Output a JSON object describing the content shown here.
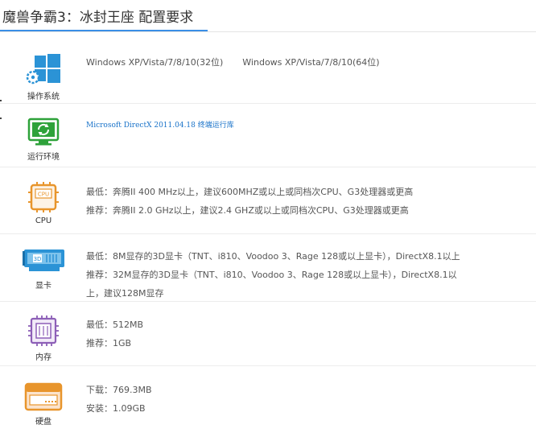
{
  "header": {
    "title": "魔兽争霸3：冰封王座 配置要求"
  },
  "colors": {
    "accent": "#3a8ee6",
    "icon_blue": "#2b93d6",
    "icon_green": "#2ea23a",
    "icon_orange": "#e8952c",
    "icon_purple": "#8d5fb7",
    "link": "#1a73c9"
  },
  "rows": [
    {
      "key": "os",
      "label": "操作系统",
      "icon": "windows-gear-icon",
      "lines": [
        "Windows XP/Vista/7/8/10(32位)",
        "Windows XP/Vista/7/8/10(64位)"
      ]
    },
    {
      "key": "runtime",
      "label": "运行环境",
      "icon": "refresh-monitor-icon",
      "lines": [
        "Microsoft DirectX 2011.04.18 终端运行库"
      ]
    },
    {
      "key": "cpu",
      "label": "CPU",
      "icon": "cpu-chip-icon",
      "lines": [
        "最低：奔腾II 400 MHz以上，建议600MHZ或以上或同档次CPU、G3处理器或更高",
        "推荐：奔腾II 2.0 GHz以上，建议2.4 GHZ或以上或同档次CPU、G3处理器或更高"
      ]
    },
    {
      "key": "gpu",
      "label": "显卡",
      "icon": "graphics-card-icon",
      "lines": [
        "最低：8M显存的3D显卡（TNT、i810、Voodoo 3、Rage 128或以上显卡），DirectX8.1以上",
        "推荐：32M显存的3D显卡（TNT、i810、Voodoo 3、Rage 128或以上显卡），DirectX8.1以",
        "上，建议128M显存"
      ]
    },
    {
      "key": "ram",
      "label": "内存",
      "icon": "memory-chip-icon",
      "lines": [
        "最低：512MB",
        "推荐：1GB"
      ]
    },
    {
      "key": "disk",
      "label": "硬盘",
      "icon": "hard-disk-icon",
      "lines": [
        "下载：769.3MB",
        "安装：1.09GB"
      ]
    }
  ]
}
